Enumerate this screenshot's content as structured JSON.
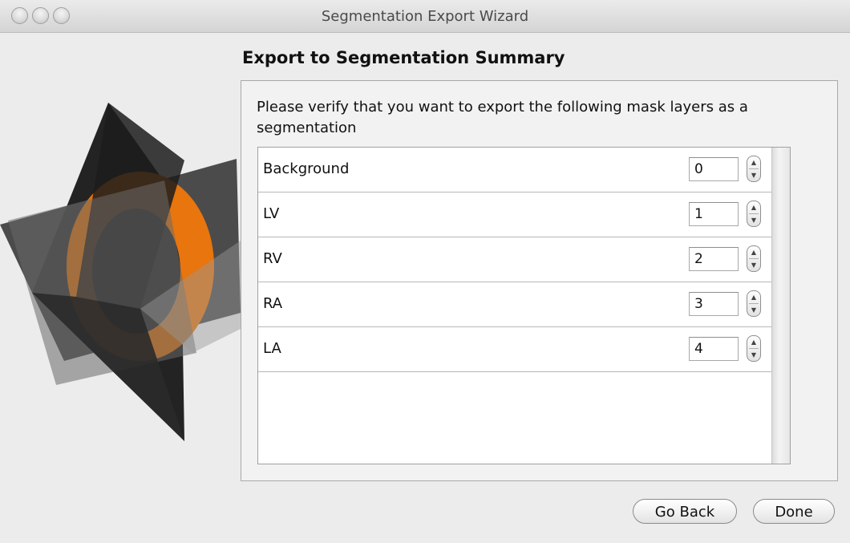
{
  "window": {
    "title": "Segmentation Export Wizard"
  },
  "page": {
    "heading": "Export to Segmentation Summary",
    "prompt": "Please verify that you want to export the following mask layers as a segmentation"
  },
  "layers": [
    {
      "label": "Background",
      "value": "0"
    },
    {
      "label": "LV",
      "value": "1"
    },
    {
      "label": "RV",
      "value": "2"
    },
    {
      "label": "RA",
      "value": "3"
    },
    {
      "label": "LA",
      "value": "4"
    }
  ],
  "buttons": {
    "back": "Go Back",
    "done": "Done"
  },
  "colors": {
    "accent": "#e8750d",
    "plane": "#2d2d2d"
  },
  "icons": {
    "stepper_up": "chevron-up-icon",
    "stepper_down": "chevron-down-icon"
  }
}
